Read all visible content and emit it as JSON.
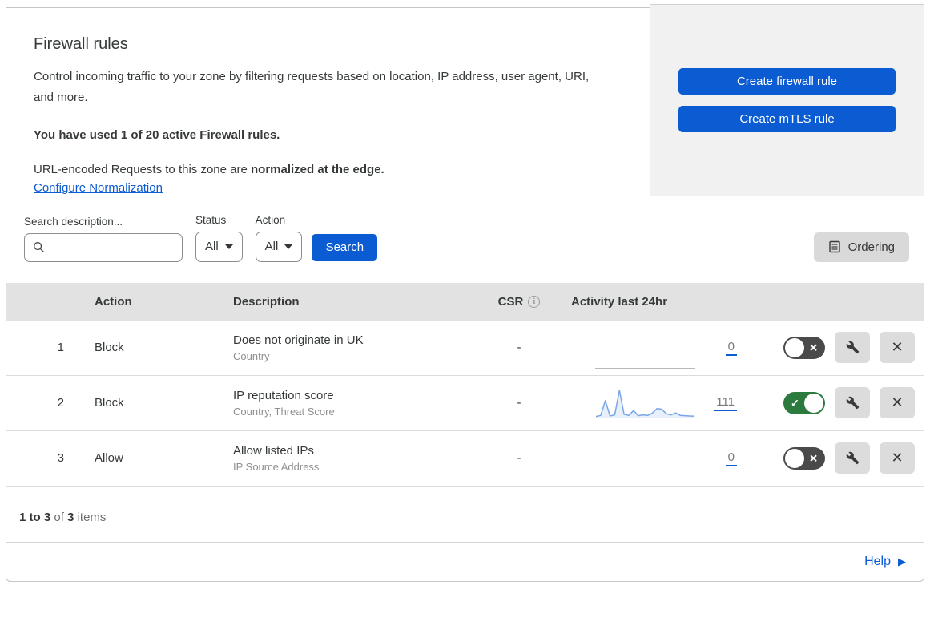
{
  "header": {
    "title": "Firewall rules",
    "description": "Control incoming traffic to your zone by filtering requests based on location, IP address, user agent, URI, and more.",
    "usage_note": "You have used 1 of 20 active Firewall rules.",
    "normalization_prefix": "URL-encoded Requests to this zone are ",
    "normalization_bold": "normalized at the edge.",
    "normalization_link": "Configure Normalization"
  },
  "cta": {
    "create_firewall_label": "Create firewall rule",
    "create_mtls_label": "Create mTLS rule"
  },
  "filters": {
    "search_label": "Search description...",
    "search_value": "",
    "status_label": "Status",
    "status_value": "All",
    "action_label": "Action",
    "action_value": "All",
    "search_button_label": "Search",
    "ordering_button_label": "Ordering"
  },
  "table": {
    "columns": {
      "action": "Action",
      "description": "Description",
      "csr": "CSR",
      "activity": "Activity last 24hr"
    },
    "rows": [
      {
        "index": "1",
        "action": "Block",
        "description": "Does not originate in UK",
        "criteria": "Country",
        "csr": "-",
        "activity_count": "0",
        "enabled": false,
        "sparkline": []
      },
      {
        "index": "2",
        "action": "Block",
        "description": "IP reputation score",
        "criteria": "Country, Threat Score",
        "csr": "-",
        "activity_count": "111",
        "enabled": true,
        "sparkline": [
          4,
          8,
          62,
          6,
          10,
          100,
          12,
          8,
          26,
          7,
          10,
          8,
          16,
          33,
          31,
          14,
          10,
          17,
          8,
          7,
          6,
          5
        ]
      },
      {
        "index": "3",
        "action": "Allow",
        "description": "Allow listed IPs",
        "criteria": "IP Source Address",
        "csr": "-",
        "activity_count": "0",
        "enabled": false,
        "sparkline": []
      }
    ],
    "summary": {
      "range": "1 to 3",
      "of": "of",
      "total": "3",
      "items": "items"
    }
  },
  "footer": {
    "help_label": "Help"
  },
  "icons": {
    "check": "✓",
    "cross": "✕",
    "info": "i",
    "help_arrow": "▶"
  },
  "colors": {
    "accent_blue": "#0b5bd3",
    "toggle_on_green": "#2c7a3e",
    "toggle_off_gray": "#4a4a4a",
    "spark_line": "#7aa5e6",
    "spark_fill": "rgba(122,165,230,0.18)"
  }
}
